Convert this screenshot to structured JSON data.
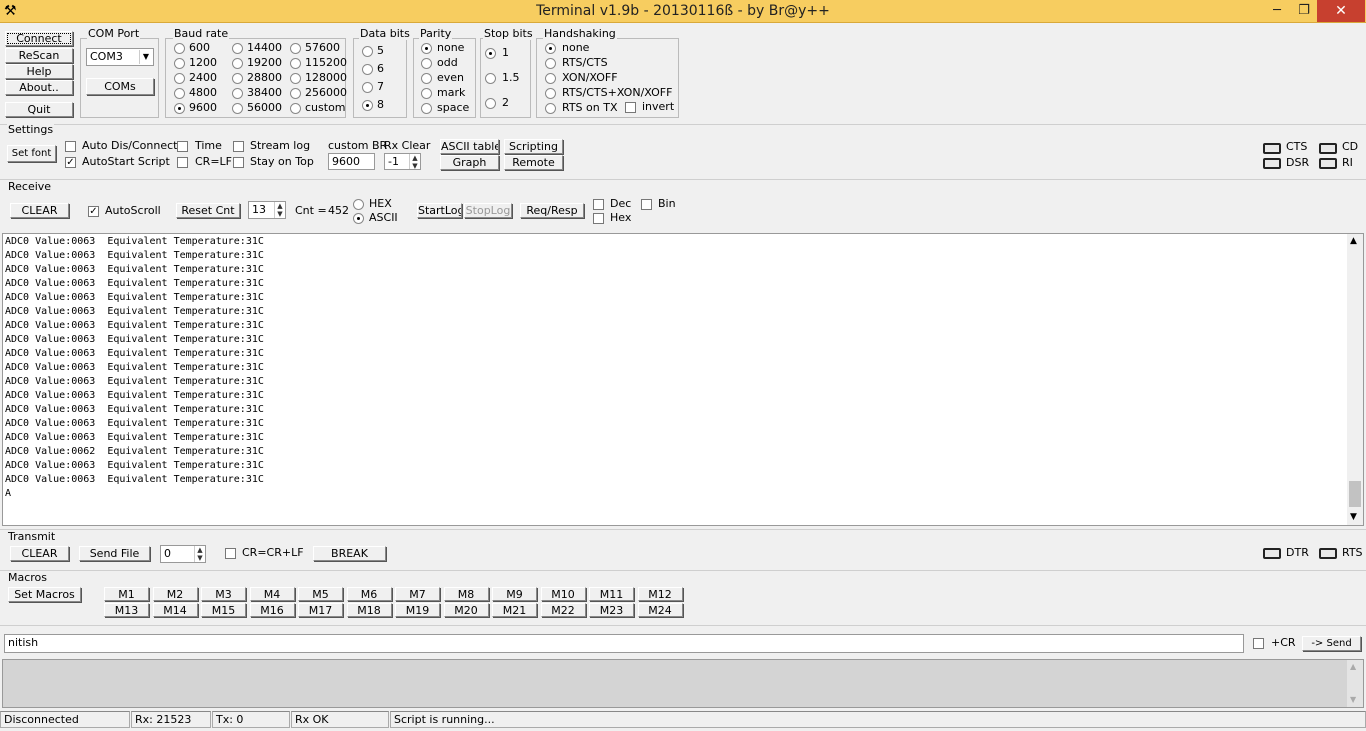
{
  "title": "Terminal v1.9b - 20130116ß - by Br@y++",
  "window": {
    "minimize": "─",
    "restore": "❐",
    "close": "✕"
  },
  "main_buttons": {
    "connect": "Connect",
    "rescan": "ReScan",
    "help": "Help",
    "about": "About..",
    "quit": "Quit"
  },
  "com_port": {
    "title": "COM Port",
    "value": "COM3",
    "coms_button": "COMs"
  },
  "baud_rate": {
    "title": "Baud rate",
    "options": [
      "600",
      "1200",
      "2400",
      "4800",
      "9600",
      "14400",
      "19200",
      "28800",
      "38400",
      "56000",
      "57600",
      "115200",
      "128000",
      "256000",
      "custom"
    ],
    "selected": "9600"
  },
  "data_bits": {
    "title": "Data bits",
    "options": [
      "5",
      "6",
      "7",
      "8"
    ],
    "selected": "8"
  },
  "parity": {
    "title": "Parity",
    "options": [
      "none",
      "odd",
      "even",
      "mark",
      "space"
    ],
    "selected": "none"
  },
  "stop_bits": {
    "title": "Stop bits",
    "options": [
      "1",
      "1.5",
      "2"
    ],
    "selected": "1"
  },
  "handshaking": {
    "title": "Handshaking",
    "options": [
      "none",
      "RTS/CTS",
      "XON/XOFF",
      "RTS/CTS+XON/XOFF",
      "RTS on TX"
    ],
    "selected": "none",
    "invert_label": "invert"
  },
  "settings": {
    "title": "Settings",
    "set_font": "Set font",
    "auto_dis_connect": "Auto Dis/Connect",
    "autostart_script": "AutoStart Script",
    "time": "Time",
    "cr_lf": "CR=LF",
    "stream_log": "Stream log",
    "stay_on_top": "Stay on Top",
    "custom_br_label": "custom BR",
    "custom_br_value": "9600",
    "rx_clear_label": "Rx Clear",
    "rx_clear_value": "-1",
    "ascii_table": "ASCII table",
    "scripting": "Scripting",
    "graph": "Graph",
    "remote": "Remote",
    "leds": {
      "cts": "CTS",
      "cd": "CD",
      "dsr": "DSR",
      "ri": "RI"
    }
  },
  "receive": {
    "title": "Receive",
    "clear": "CLEAR",
    "autoscroll": "AutoScroll",
    "reset_cnt": "Reset Cnt",
    "cnt_spin": "13",
    "cnt_label": "Cnt =",
    "cnt_value": "452",
    "hex": "HEX",
    "ascii": "ASCII",
    "startlog": "StartLog",
    "stoplog": "StopLog",
    "reqresp": "Req/Resp",
    "dec": "Dec",
    "hex_chk": "Hex",
    "bin": "Bin",
    "lines": [
      "ADC0 Value:0063  Equivalent Temperature:31C",
      "ADC0 Value:0063  Equivalent Temperature:31C",
      "ADC0 Value:0063  Equivalent Temperature:31C",
      "ADC0 Value:0063  Equivalent Temperature:31C",
      "ADC0 Value:0063  Equivalent Temperature:31C",
      "ADC0 Value:0063  Equivalent Temperature:31C",
      "ADC0 Value:0063  Equivalent Temperature:31C",
      "ADC0 Value:0063  Equivalent Temperature:31C",
      "ADC0 Value:0063  Equivalent Temperature:31C",
      "ADC0 Value:0063  Equivalent Temperature:31C",
      "ADC0 Value:0063  Equivalent Temperature:31C",
      "ADC0 Value:0063  Equivalent Temperature:31C",
      "ADC0 Value:0063  Equivalent Temperature:31C",
      "ADC0 Value:0063  Equivalent Temperature:31C",
      "ADC0 Value:0063  Equivalent Temperature:31C",
      "ADC0 Value:0062  Equivalent Temperature:31C",
      "ADC0 Value:0063  Equivalent Temperature:31C",
      "ADC0 Value:0063  Equivalent Temperature:31C",
      "A"
    ]
  },
  "transmit": {
    "title": "Transmit",
    "clear": "CLEAR",
    "send_file": "Send File",
    "spin": "0",
    "cr_crlf": "CR=CR+LF",
    "break": "BREAK",
    "dtr": "DTR",
    "rts": "RTS"
  },
  "macros": {
    "title": "Macros",
    "set_macros": "Set Macros",
    "row1": [
      "M1",
      "M2",
      "M3",
      "M4",
      "M5",
      "M6",
      "M7",
      "M8",
      "M9",
      "M10",
      "M11",
      "M12"
    ],
    "row2": [
      "M13",
      "M14",
      "M15",
      "M16",
      "M17",
      "M18",
      "M19",
      "M20",
      "M21",
      "M22",
      "M23",
      "M24"
    ]
  },
  "send_line": {
    "value": "nitish",
    "plus_cr": "+CR",
    "send": "-> Send"
  },
  "status": {
    "connection": "Disconnected",
    "rx": "Rx: 21523",
    "tx": "Tx: 0",
    "rx_ok": "Rx OK",
    "script": "Script is running..."
  }
}
